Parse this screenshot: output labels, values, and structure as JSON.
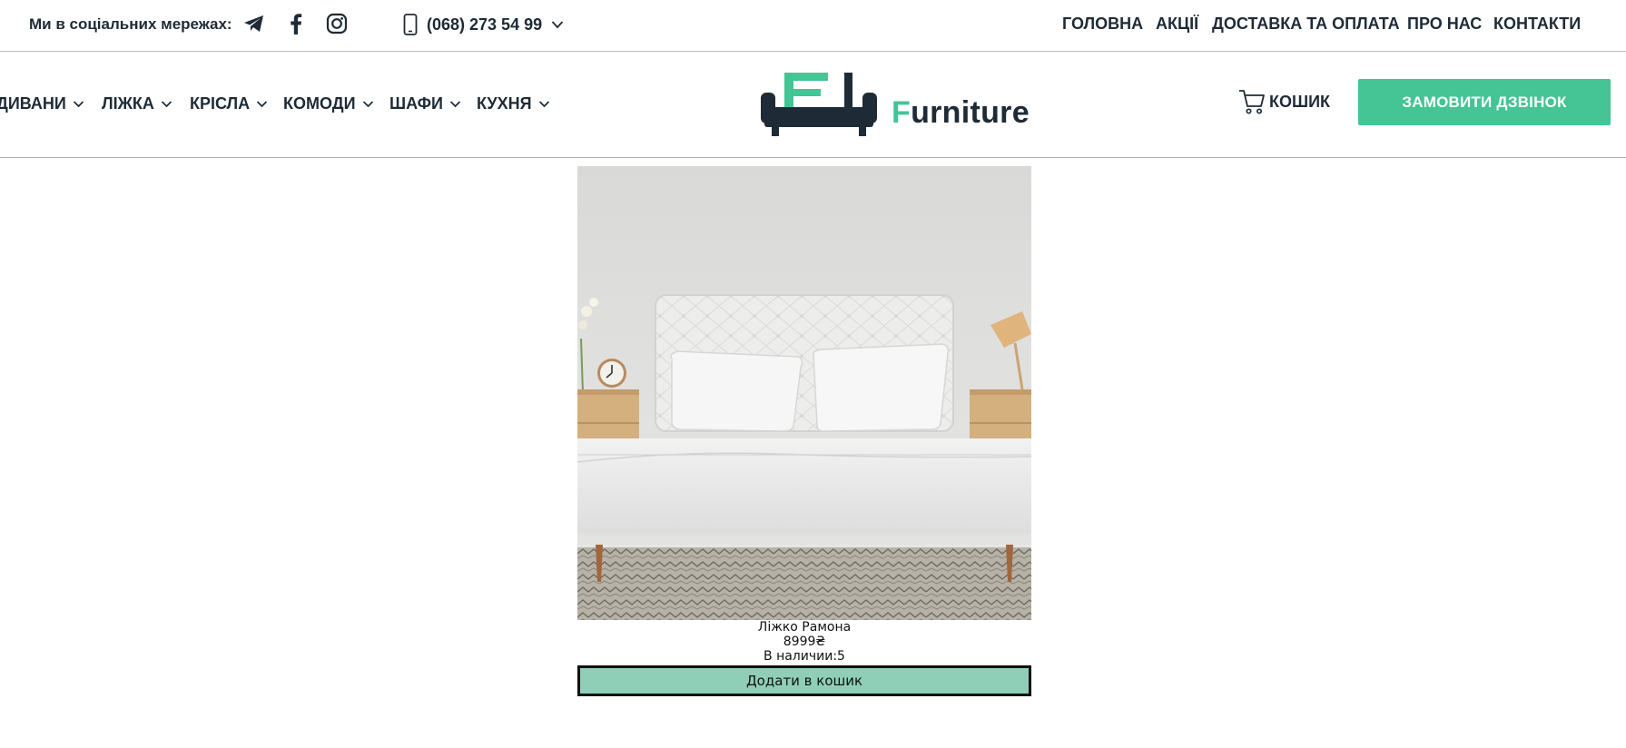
{
  "topbar": {
    "social_label": "Ми в соціальних мережах:",
    "social_icons": [
      "telegram-icon",
      "facebook-icon",
      "instagram-icon"
    ],
    "phone": "(068) 273 54 99",
    "nav": [
      "ГОЛОВНА",
      "АКЦІЇ",
      "ДОСТАВКА ТА ОПЛАТА",
      "ПРО НАС",
      "КОНТАКТИ"
    ]
  },
  "header": {
    "categories": [
      "ДИВАНИ",
      "ЛІЖКА",
      "КРІСЛА",
      "КОМОДИ",
      "ШАФИ",
      "КУХНЯ"
    ],
    "logo_first_letter": "F",
    "logo_rest": "urniture",
    "cart_label": "КОШИК",
    "call_button": "ЗАМОВИТИ ДЗВІНОК"
  },
  "product": {
    "name": "Ліжко Рамона",
    "price": "8999₴",
    "stock_label": "В наличии:",
    "stock_value": "5",
    "add_button": "Додати в кошик"
  },
  "colors": {
    "accent": "#45c495",
    "text_dark": "#1e2b36",
    "add_button_bg": "#8fcfb7"
  }
}
